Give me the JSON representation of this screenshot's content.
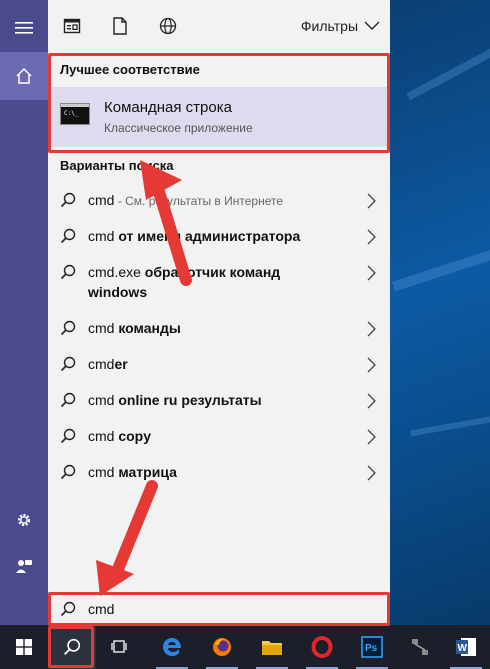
{
  "topbar": {
    "filters_label": "Фильтры"
  },
  "best_match": {
    "header": "Лучшее соответствие",
    "title": "Командная строка",
    "subtitle": "Классическое приложение"
  },
  "suggestions": {
    "header": "Варианты поиска",
    "items": [
      {
        "prefix": "cmd",
        "bold": "",
        "hint": " - См. результаты в Интернете"
      },
      {
        "prefix": "cmd",
        "bold": " от имени администратора",
        "hint": ""
      },
      {
        "prefix": "cmd.exe",
        "bold": " обработчик команд windows",
        "hint": ""
      },
      {
        "prefix": "cmd",
        "bold": " команды",
        "hint": ""
      },
      {
        "prefix": "cmd",
        "bold": "er",
        "hint": ""
      },
      {
        "prefix": "cmd",
        "bold": " online ru результаты",
        "hint": ""
      },
      {
        "prefix": "cmd",
        "bold": " copy",
        "hint": ""
      },
      {
        "prefix": "cmd",
        "bold": " матрица",
        "hint": ""
      }
    ]
  },
  "search": {
    "value": "cmd"
  },
  "colors": {
    "rail": "#4c4a8e",
    "highlight": "#dcdcee",
    "annotation": "#e53935",
    "taskbar": "#1b1f2a"
  }
}
